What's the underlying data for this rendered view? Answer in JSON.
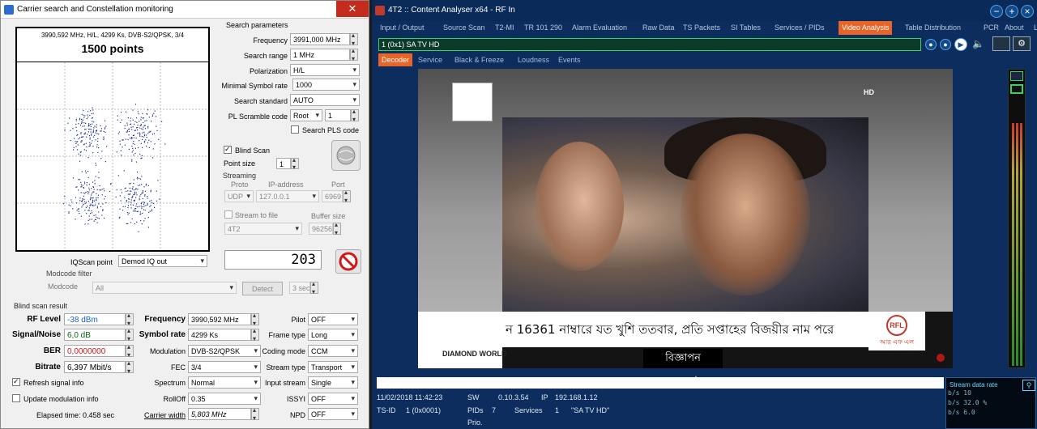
{
  "left_window": {
    "title": "Carrier search and Constellation monitoring",
    "close_glyph": "✕",
    "plot": {
      "subtitle": "3990,592 MHz, H/L, 4299 Ks, DVB-S2/QPSK, 3/4",
      "points_label": "1500 points"
    },
    "search_params": {
      "header": "Search parameters",
      "frequency_label": "Frequency",
      "frequency_value": "3991,000 MHz",
      "range_label": "Search range",
      "range_value": "1 MHz",
      "polarization_label": "Polarization",
      "polarization_value": "H/L",
      "min_symbol_label": "Minimal Symbol rate",
      "min_symbol_value": "1000",
      "standard_label": "Search standard",
      "standard_value": "AUTO",
      "scramble_label": "PL Scramble code",
      "scramble_type": "Root",
      "scramble_value": "1",
      "search_pls_label": "Search PLS code"
    },
    "blind_scan": {
      "label": "Blind Scan",
      "point_size_label": "Point size",
      "point_size_value": "1"
    },
    "streaming": {
      "header": "Streaming",
      "proto_label": "Proto",
      "ip_label": "IP-address",
      "port_label": "Port",
      "proto_value": "UDP",
      "ip_value": "127.0.0.1",
      "port_value": "6969",
      "to_file_label": "Stream to file",
      "buffer_label": "Buffer size",
      "file_value": "4T2",
      "buffer_value": "96256"
    },
    "counter": "203",
    "iqscan_label": "IQScan point",
    "iqscan_value": "Demod IQ out",
    "modcode": {
      "header": "Modcode filter",
      "label": "Modcode",
      "value": "All",
      "detect_button": "Detect",
      "time_value": "3 sec"
    },
    "result": {
      "header": "Blind scan result",
      "rf_label": "RF Level",
      "rf_value": "-38 dBm",
      "sn_label": "Signal/Noise",
      "sn_value": "6,0 dB",
      "ber_label": "BER",
      "ber_value": "0,0000000",
      "bitrate_label": "Bitrate",
      "bitrate_value": "6,397 Mbit/s",
      "freq_label": "Frequency",
      "freq_value": "3990,592 MHz",
      "symrate_label": "Symbol rate",
      "symrate_value": "4299 Ks",
      "modulation_label": "Modulation",
      "modulation_value": "DVB-S2/QPSK",
      "fec_label": "FEC",
      "fec_value": "3/4",
      "spectrum_label": "Spectrum",
      "spectrum_value": "Normal",
      "rolloff_label": "RollOff",
      "rolloff_value": "0.35",
      "carrier_width_label": "Carrier width",
      "carrier_width_value": "5,803 MHz",
      "pilot_label": "Pilot",
      "pilot_value": "OFF",
      "frame_label": "Frame type",
      "frame_value": "Long",
      "coding_label": "Coding mode",
      "coding_value": "CCM",
      "stream_type_label": "Stream type",
      "stream_type_value": "Transport",
      "input_stream_label": "Input stream",
      "input_stream_value": "Single",
      "issyi_label": "ISSYI",
      "issyi_value": "OFF",
      "npd_label": "NPD",
      "npd_value": "OFF"
    },
    "refresh_label": "Refresh signal info",
    "update_mod_label": "Update modulation info",
    "elapsed": "Elapsed time: 0.458 sec"
  },
  "right_window": {
    "title": "4T2 :: Content Analyser x64  - RF In",
    "tabs": [
      "Input / Output",
      "Source Scan",
      "T2-MI",
      "TR 101 290",
      "Alarm Evaluation",
      "Raw Data",
      "TS Packets",
      "SI Tables",
      "Services / PIDs",
      "Video Analysis",
      "Table Distribution",
      "PCR",
      "About",
      "Log"
    ],
    "active_tab": "Video Analysis",
    "stream": "1 (0x1) SA TV HD",
    "subtabs": [
      "Decoder",
      "Service",
      "Black & Freeze",
      "Loudness",
      "Events"
    ],
    "video": {
      "hd_badge": "HD",
      "ticker": "ন 16361 নাম্বারে যত খুশি ততবার, প্রতি সপ্তাহের বিজয়ীর নাম পরে",
      "ad_label": "বিজ্ঞাপন",
      "brand": "DIAMOND WORLD",
      "rf_logo_text": "আর এফ এল",
      "rf_ring": "RFL"
    },
    "status": {
      "datetime": "11/02/2018 11:42:23",
      "sw_label": "SW",
      "sw_value": "0.10.3.54",
      "ip_label": "IP",
      "ip_value": "192.168.1.12",
      "tsid_label": "TS-ID",
      "tsid_value": "1 (0x0001)",
      "pids_label": "PIDs",
      "pids_value": "7",
      "services_label": "Services",
      "services_value": "1",
      "service_name": "\"SA TV HD\"",
      "prio_label": "Prio."
    },
    "rate": {
      "title": "Stream data rate",
      "rows": [
        "b/s  10",
        "b/s  32.0 %",
        "b/s  6.0"
      ]
    }
  },
  "constellation": {
    "description_points": 1500,
    "seed": 7
  },
  "colors": {
    "constellation_dot": "#1a2b9a",
    "rf_blue": "#1a5fd0",
    "ber_red": "#d01818",
    "accent_orange": "#e8652a"
  }
}
